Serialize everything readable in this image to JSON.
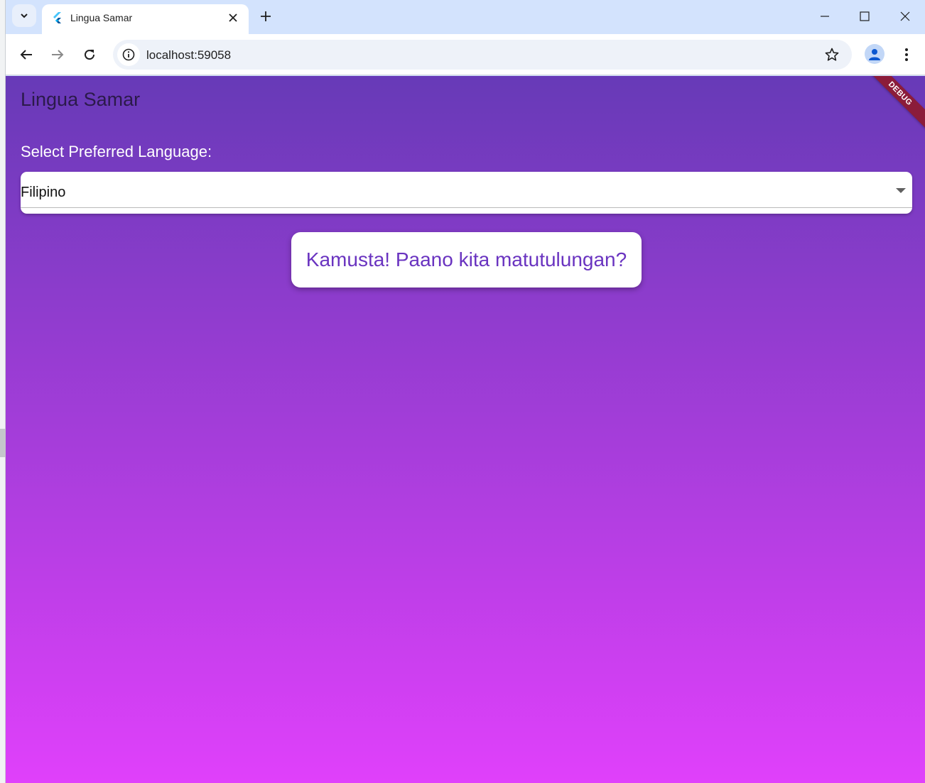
{
  "browser": {
    "tab": {
      "title": "Lingua Samar"
    },
    "address_bar": {
      "url": "localhost:59058"
    }
  },
  "app": {
    "title": "Lingua Samar",
    "debug_banner": "DEBUG",
    "language_label": "Select Preferred Language:",
    "language_dropdown": {
      "selected": "Filipino"
    },
    "greeting": "Kamusta! Paano kita matutulungan?"
  },
  "colors": {
    "gradient_top": "#673ab7",
    "gradient_bottom": "#e040fb",
    "greeting_text": "#6a34c0",
    "debug_banner": "#8b1c3a"
  },
  "icons": {
    "tab_search": "chevron-down-icon",
    "favicon": "flutter-icon",
    "tab_close": "close-icon",
    "new_tab": "plus-icon",
    "minimize": "minimize-icon",
    "maximize": "maximize-icon",
    "close_window": "close-icon",
    "back": "arrow-left-icon",
    "forward": "arrow-right-icon",
    "reload": "reload-icon",
    "site_info": "info-icon",
    "bookmark": "star-icon",
    "profile": "person-icon",
    "menu": "more-vert-icon",
    "dropdown": "caret-down-icon"
  }
}
